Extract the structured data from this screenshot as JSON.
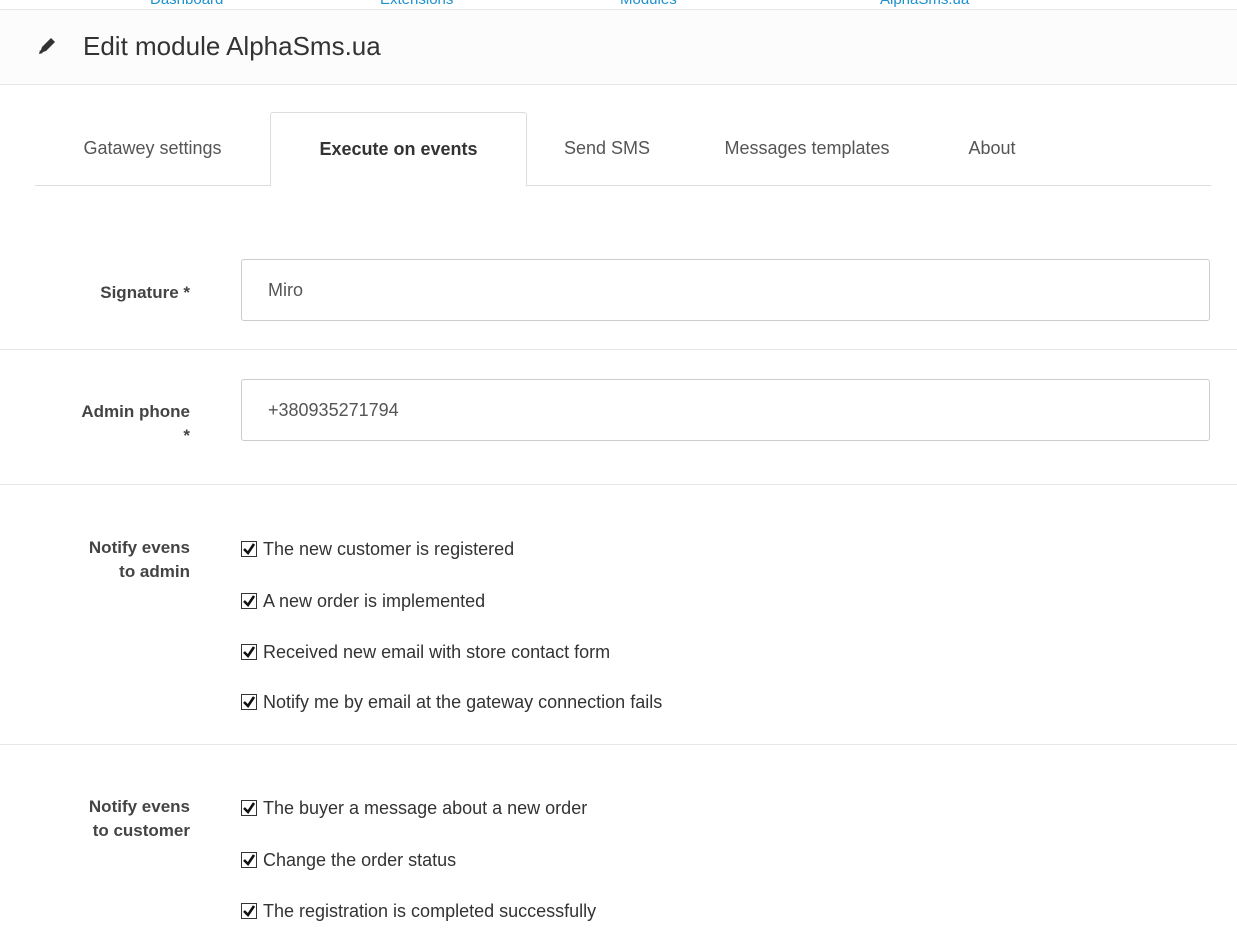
{
  "breadcrumb_strip": [
    "Dashboard",
    "Extensions",
    "Modules",
    "AlphaSms.ua"
  ],
  "heading": {
    "title": "Edit module AlphaSms.ua",
    "icon": "pencil-icon"
  },
  "tabs": [
    {
      "label": "Gatawey settings",
      "active": false
    },
    {
      "label": "Execute on events",
      "active": true
    },
    {
      "label": "Send SMS",
      "active": false
    },
    {
      "label": "Messages templates",
      "active": false
    },
    {
      "label": "About",
      "active": false
    }
  ],
  "form": {
    "signature": {
      "label": "Signature *",
      "value": "Miro"
    },
    "admin_phone": {
      "label_line1": "Admin phone",
      "label_line2": "*",
      "value": "+380935271794"
    },
    "admin_events": {
      "label_line1": "Notify evens",
      "label_line2": "to admin",
      "options": [
        {
          "label": "The new customer is registered",
          "checked": true
        },
        {
          "label": "A new order is implemented",
          "checked": true
        },
        {
          "label": "Received new email with store contact form",
          "checked": true
        },
        {
          "label": "Notify me by email at the gateway connection fails",
          "checked": true
        }
      ]
    },
    "customer_events": {
      "label_line1": "Notify evens",
      "label_line2": "to customer",
      "options": [
        {
          "label": "The buyer a message about a new order",
          "checked": true
        },
        {
          "label": "Change the order status",
          "checked": true
        },
        {
          "label": "The registration is completed successfully",
          "checked": true
        }
      ]
    }
  },
  "colors": {
    "link": "#1e91cf",
    "border": "#dddddd",
    "heading_bg": "#fcfcfc"
  }
}
